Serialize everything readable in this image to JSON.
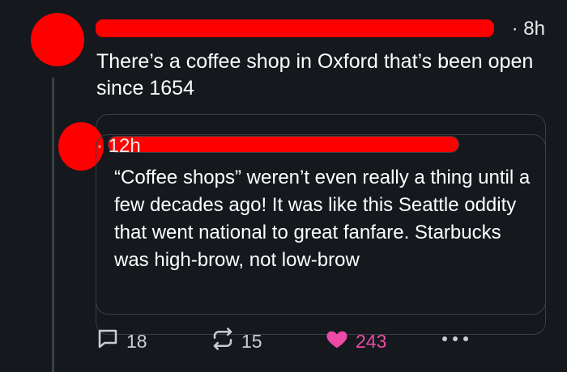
{
  "post": {
    "time": "· 8h",
    "text": "There’s a coffee shop in Oxford that’s been open since 1654"
  },
  "quote": {
    "time": "· 12h",
    "text": "“Coffee shops” weren’t even really a thing until a few decades ago! It was like this Seattle oddity that went national to great fanfare. Starbucks was high-brow, not low-brow"
  },
  "actions": {
    "replies": "18",
    "reposts": "15",
    "likes": "243",
    "like_color": "#ec4aa6",
    "redaction_color": "#ff0000"
  }
}
